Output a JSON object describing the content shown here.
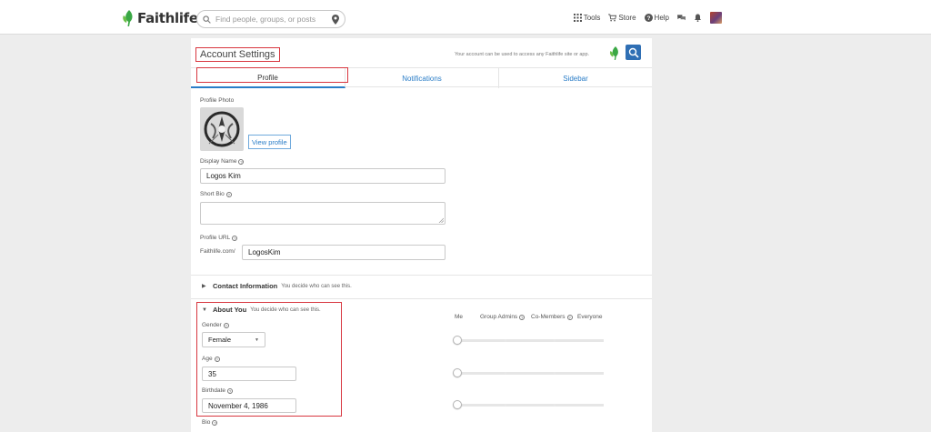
{
  "topbar": {
    "logo_text": "Faithlife",
    "search_placeholder": "Find people, groups, or posts",
    "nav": {
      "tools": "Tools",
      "store": "Store",
      "help": "Help"
    }
  },
  "page": {
    "title": "Account Settings",
    "header_note": "Your account can be used to access any Faithlife site or app."
  },
  "tabs": [
    {
      "label": "Profile"
    },
    {
      "label": "Notifications"
    },
    {
      "label": "Sidebar"
    }
  ],
  "profile": {
    "photo_label": "Profile Photo",
    "view_profile_label": "View profile",
    "display_name_label": "Display Name",
    "display_name_value": "Logos Kim",
    "short_bio_label": "Short Bio",
    "short_bio_value": "",
    "profile_url_label": "Profile URL",
    "profile_url_prefix": "Faithlife.com/",
    "profile_url_value": "LogosKim"
  },
  "contact": {
    "title": "Contact Information",
    "subtitle": "You decide who can see this."
  },
  "about": {
    "title": "About You",
    "subtitle": "You decide who can see this.",
    "visibility_headers": [
      "Me",
      "Group Admins",
      "Co-Members",
      "Everyone"
    ],
    "gender_label": "Gender",
    "gender_value": "Female",
    "age_label": "Age",
    "age_value": "35",
    "birthdate_label": "Birthdate",
    "birthdate_value": "November 4, 1986",
    "bio_label": "Bio",
    "visibility_levels": {
      "gender": 0,
      "age": 0,
      "birthdate": 0
    }
  },
  "colors": {
    "brand_green": "#3aa845",
    "link_blue": "#2a7dc7",
    "highlight_red": "#d8363f"
  }
}
